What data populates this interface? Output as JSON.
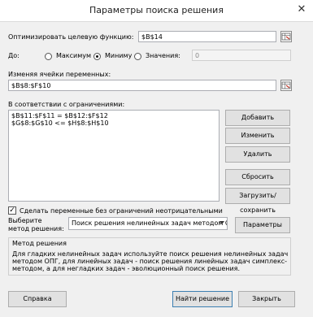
{
  "window": {
    "title": "Параметры поиска решения",
    "close_glyph": "✕"
  },
  "objective": {
    "label": "Оптимизировать целевую функцию:",
    "value": "$B$14"
  },
  "to": {
    "label": "До:",
    "options": [
      {
        "label": "Максимум",
        "selected": false
      },
      {
        "label": "Миниму",
        "selected": true
      },
      {
        "label": "Значения:",
        "selected": false
      }
    ],
    "value_field": "0"
  },
  "variables": {
    "label": "Изменяя ячейки переменных:",
    "value": "$B$8:$F$10"
  },
  "constraints": {
    "label": "В соответствии с ограничениями:",
    "items": [
      "$B$11:$F$11 = $B$12:$F$12",
      "$G$8:$G$10 <= $H$8:$H$10"
    ],
    "buttons": {
      "add": "Добавить",
      "change": "Изменить",
      "delete": "Удалить",
      "reset": "Сбросить",
      "load_save": "Загрузить/сохранить"
    }
  },
  "nonneg": {
    "label": "Сделать переменные без ограничений неотрицательными",
    "checked": true
  },
  "method": {
    "label_line1": "Выберите",
    "label_line2": "метод решения:",
    "selected": "Поиск решения нелинейных задач методом ОПГ",
    "params_button": "Параметры"
  },
  "method_box": {
    "title": "Метод решения",
    "text": "Для гладких нелинейных задач используйте поиск решения нелинейных задач методом ОПГ, для линейных задач - поиск решения линейных задач симплекс-методом, а для негладких задач - эволюционный поиск решения."
  },
  "footer": {
    "help": "Справка",
    "solve": "Найти решение",
    "close": "Закрыть"
  }
}
